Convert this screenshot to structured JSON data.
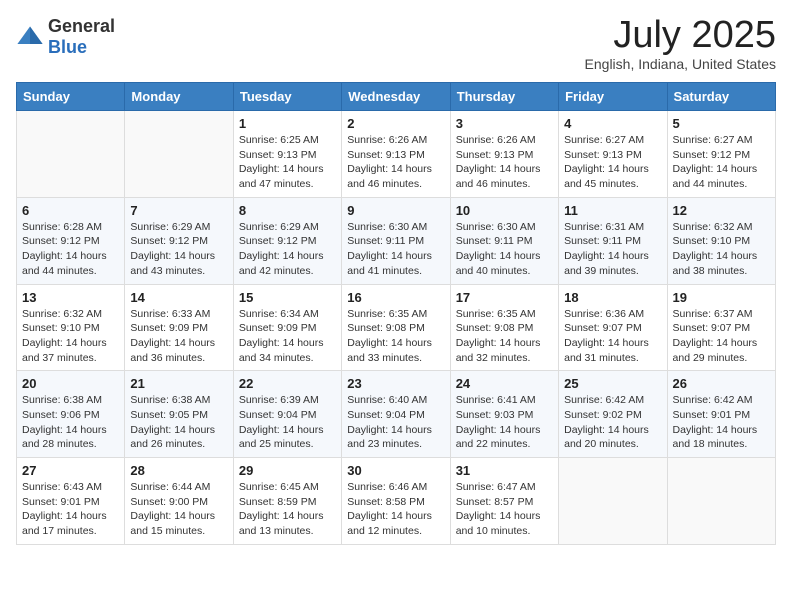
{
  "header": {
    "logo_general": "General",
    "logo_blue": "Blue",
    "month_title": "July 2025",
    "subtitle": "English, Indiana, United States"
  },
  "days_of_week": [
    "Sunday",
    "Monday",
    "Tuesday",
    "Wednesday",
    "Thursday",
    "Friday",
    "Saturday"
  ],
  "weeks": [
    [
      {
        "day": "",
        "sunrise": "",
        "sunset": "",
        "daylight": ""
      },
      {
        "day": "",
        "sunrise": "",
        "sunset": "",
        "daylight": ""
      },
      {
        "day": "1",
        "sunrise": "Sunrise: 6:25 AM",
        "sunset": "Sunset: 9:13 PM",
        "daylight": "Daylight: 14 hours and 47 minutes."
      },
      {
        "day": "2",
        "sunrise": "Sunrise: 6:26 AM",
        "sunset": "Sunset: 9:13 PM",
        "daylight": "Daylight: 14 hours and 46 minutes."
      },
      {
        "day": "3",
        "sunrise": "Sunrise: 6:26 AM",
        "sunset": "Sunset: 9:13 PM",
        "daylight": "Daylight: 14 hours and 46 minutes."
      },
      {
        "day": "4",
        "sunrise": "Sunrise: 6:27 AM",
        "sunset": "Sunset: 9:13 PM",
        "daylight": "Daylight: 14 hours and 45 minutes."
      },
      {
        "day": "5",
        "sunrise": "Sunrise: 6:27 AM",
        "sunset": "Sunset: 9:12 PM",
        "daylight": "Daylight: 14 hours and 44 minutes."
      }
    ],
    [
      {
        "day": "6",
        "sunrise": "Sunrise: 6:28 AM",
        "sunset": "Sunset: 9:12 PM",
        "daylight": "Daylight: 14 hours and 44 minutes."
      },
      {
        "day": "7",
        "sunrise": "Sunrise: 6:29 AM",
        "sunset": "Sunset: 9:12 PM",
        "daylight": "Daylight: 14 hours and 43 minutes."
      },
      {
        "day": "8",
        "sunrise": "Sunrise: 6:29 AM",
        "sunset": "Sunset: 9:12 PM",
        "daylight": "Daylight: 14 hours and 42 minutes."
      },
      {
        "day": "9",
        "sunrise": "Sunrise: 6:30 AM",
        "sunset": "Sunset: 9:11 PM",
        "daylight": "Daylight: 14 hours and 41 minutes."
      },
      {
        "day": "10",
        "sunrise": "Sunrise: 6:30 AM",
        "sunset": "Sunset: 9:11 PM",
        "daylight": "Daylight: 14 hours and 40 minutes."
      },
      {
        "day": "11",
        "sunrise": "Sunrise: 6:31 AM",
        "sunset": "Sunset: 9:11 PM",
        "daylight": "Daylight: 14 hours and 39 minutes."
      },
      {
        "day": "12",
        "sunrise": "Sunrise: 6:32 AM",
        "sunset": "Sunset: 9:10 PM",
        "daylight": "Daylight: 14 hours and 38 minutes."
      }
    ],
    [
      {
        "day": "13",
        "sunrise": "Sunrise: 6:32 AM",
        "sunset": "Sunset: 9:10 PM",
        "daylight": "Daylight: 14 hours and 37 minutes."
      },
      {
        "day": "14",
        "sunrise": "Sunrise: 6:33 AM",
        "sunset": "Sunset: 9:09 PM",
        "daylight": "Daylight: 14 hours and 36 minutes."
      },
      {
        "day": "15",
        "sunrise": "Sunrise: 6:34 AM",
        "sunset": "Sunset: 9:09 PM",
        "daylight": "Daylight: 14 hours and 34 minutes."
      },
      {
        "day": "16",
        "sunrise": "Sunrise: 6:35 AM",
        "sunset": "Sunset: 9:08 PM",
        "daylight": "Daylight: 14 hours and 33 minutes."
      },
      {
        "day": "17",
        "sunrise": "Sunrise: 6:35 AM",
        "sunset": "Sunset: 9:08 PM",
        "daylight": "Daylight: 14 hours and 32 minutes."
      },
      {
        "day": "18",
        "sunrise": "Sunrise: 6:36 AM",
        "sunset": "Sunset: 9:07 PM",
        "daylight": "Daylight: 14 hours and 31 minutes."
      },
      {
        "day": "19",
        "sunrise": "Sunrise: 6:37 AM",
        "sunset": "Sunset: 9:07 PM",
        "daylight": "Daylight: 14 hours and 29 minutes."
      }
    ],
    [
      {
        "day": "20",
        "sunrise": "Sunrise: 6:38 AM",
        "sunset": "Sunset: 9:06 PM",
        "daylight": "Daylight: 14 hours and 28 minutes."
      },
      {
        "day": "21",
        "sunrise": "Sunrise: 6:38 AM",
        "sunset": "Sunset: 9:05 PM",
        "daylight": "Daylight: 14 hours and 26 minutes."
      },
      {
        "day": "22",
        "sunrise": "Sunrise: 6:39 AM",
        "sunset": "Sunset: 9:04 PM",
        "daylight": "Daylight: 14 hours and 25 minutes."
      },
      {
        "day": "23",
        "sunrise": "Sunrise: 6:40 AM",
        "sunset": "Sunset: 9:04 PM",
        "daylight": "Daylight: 14 hours and 23 minutes."
      },
      {
        "day": "24",
        "sunrise": "Sunrise: 6:41 AM",
        "sunset": "Sunset: 9:03 PM",
        "daylight": "Daylight: 14 hours and 22 minutes."
      },
      {
        "day": "25",
        "sunrise": "Sunrise: 6:42 AM",
        "sunset": "Sunset: 9:02 PM",
        "daylight": "Daylight: 14 hours and 20 minutes."
      },
      {
        "day": "26",
        "sunrise": "Sunrise: 6:42 AM",
        "sunset": "Sunset: 9:01 PM",
        "daylight": "Daylight: 14 hours and 18 minutes."
      }
    ],
    [
      {
        "day": "27",
        "sunrise": "Sunrise: 6:43 AM",
        "sunset": "Sunset: 9:01 PM",
        "daylight": "Daylight: 14 hours and 17 minutes."
      },
      {
        "day": "28",
        "sunrise": "Sunrise: 6:44 AM",
        "sunset": "Sunset: 9:00 PM",
        "daylight": "Daylight: 14 hours and 15 minutes."
      },
      {
        "day": "29",
        "sunrise": "Sunrise: 6:45 AM",
        "sunset": "Sunset: 8:59 PM",
        "daylight": "Daylight: 14 hours and 13 minutes."
      },
      {
        "day": "30",
        "sunrise": "Sunrise: 6:46 AM",
        "sunset": "Sunset: 8:58 PM",
        "daylight": "Daylight: 14 hours and 12 minutes."
      },
      {
        "day": "31",
        "sunrise": "Sunrise: 6:47 AM",
        "sunset": "Sunset: 8:57 PM",
        "daylight": "Daylight: 14 hours and 10 minutes."
      },
      {
        "day": "",
        "sunrise": "",
        "sunset": "",
        "daylight": ""
      },
      {
        "day": "",
        "sunrise": "",
        "sunset": "",
        "daylight": ""
      }
    ]
  ]
}
